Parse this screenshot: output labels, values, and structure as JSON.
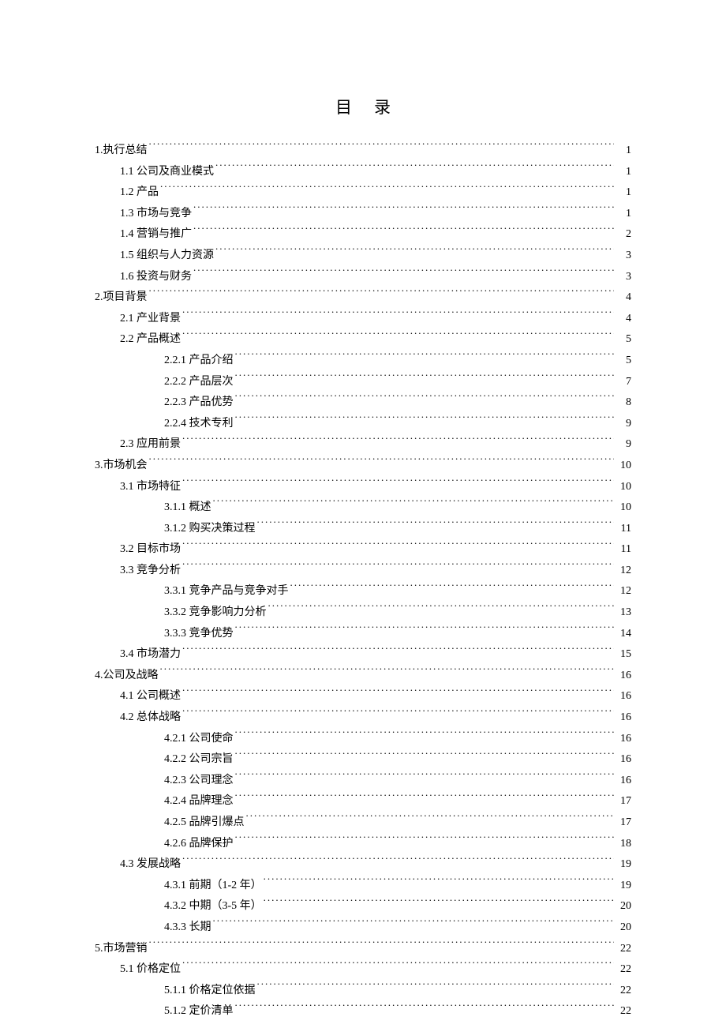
{
  "title": "目录",
  "entries": [
    {
      "level": 1,
      "label": "1.执行总结",
      "page": "1"
    },
    {
      "level": 2,
      "label": "1.1 公司及商业模式",
      "page": "1"
    },
    {
      "level": 2,
      "label": "1.2 产品",
      "page": "1"
    },
    {
      "level": 2,
      "label": "1.3 市场与竞争",
      "page": "1"
    },
    {
      "level": 2,
      "label": "1.4 营销与推广",
      "page": "2"
    },
    {
      "level": 2,
      "label": "1.5 组织与人力资源",
      "page": "3"
    },
    {
      "level": 2,
      "label": "1.6 投资与财务",
      "page": "3"
    },
    {
      "level": 1,
      "label": "2.项目背景",
      "page": "4"
    },
    {
      "level": 2,
      "label": "2.1 产业背景",
      "page": "4"
    },
    {
      "level": 2,
      "label": "2.2 产品概述",
      "page": "5"
    },
    {
      "level": 3,
      "label": "2.2.1 产品介绍",
      "page": "5"
    },
    {
      "level": 3,
      "label": "2.2.2 产品层次",
      "page": "7"
    },
    {
      "level": 3,
      "label": "2.2.3 产品优势",
      "page": "8"
    },
    {
      "level": 3,
      "label": "2.2.4 技术专利",
      "page": "9"
    },
    {
      "level": 2,
      "label": "2.3 应用前景",
      "page": "9"
    },
    {
      "level": 1,
      "label": "3.市场机会",
      "page": "10"
    },
    {
      "level": 2,
      "label": "3.1 市场特征",
      "page": "10"
    },
    {
      "level": 3,
      "label": "3.1.1 概述",
      "page": "10"
    },
    {
      "level": 3,
      "label": "3.1.2 购买决策过程",
      "page": "11"
    },
    {
      "level": 2,
      "label": "3.2 目标市场",
      "page": "11"
    },
    {
      "level": 2,
      "label": "3.3 竞争分析",
      "page": "12"
    },
    {
      "level": 3,
      "label": "3.3.1 竞争产品与竞争对手",
      "page": "12"
    },
    {
      "level": 3,
      "label": "3.3.2 竞争影响力分析",
      "page": "13"
    },
    {
      "level": 3,
      "label": "3.3.3 竞争优势",
      "page": "14"
    },
    {
      "level": 2,
      "label": "3.4 市场潜力",
      "page": "15"
    },
    {
      "level": 1,
      "label": "4.公司及战略",
      "page": "16"
    },
    {
      "level": 2,
      "label": "4.1 公司概述",
      "page": "16"
    },
    {
      "level": 2,
      "label": "4.2 总体战略",
      "page": "16"
    },
    {
      "level": 3,
      "label": "4.2.1 公司使命",
      "page": "16"
    },
    {
      "level": 3,
      "label": "4.2.2 公司宗旨",
      "page": "16"
    },
    {
      "level": 3,
      "label": "4.2.3 公司理念",
      "page": "16"
    },
    {
      "level": 3,
      "label": "4.2.4 品牌理念",
      "page": "17"
    },
    {
      "level": 3,
      "label": "4.2.5 品牌引爆点",
      "page": "17"
    },
    {
      "level": 3,
      "label": "4.2.6 品牌保护",
      "page": "18"
    },
    {
      "level": 2,
      "label": "4.3 发展战略",
      "page": "19"
    },
    {
      "level": 3,
      "label": "4.3.1 前期（1-2 年）",
      "page": "19"
    },
    {
      "level": 3,
      "label": "4.3.2 中期（3-5 年）",
      "page": "20"
    },
    {
      "level": 3,
      "label": "4.3.3 长期",
      "page": "20"
    },
    {
      "level": 1,
      "label": "5.市场营销",
      "page": "22"
    },
    {
      "level": 2,
      "label": "5.1 价格定位",
      "page": "22"
    },
    {
      "level": 3,
      "label": "5.1.1 价格定位依据",
      "page": "22"
    },
    {
      "level": 3,
      "label": "5.1.2 定价清单",
      "page": "22"
    }
  ]
}
